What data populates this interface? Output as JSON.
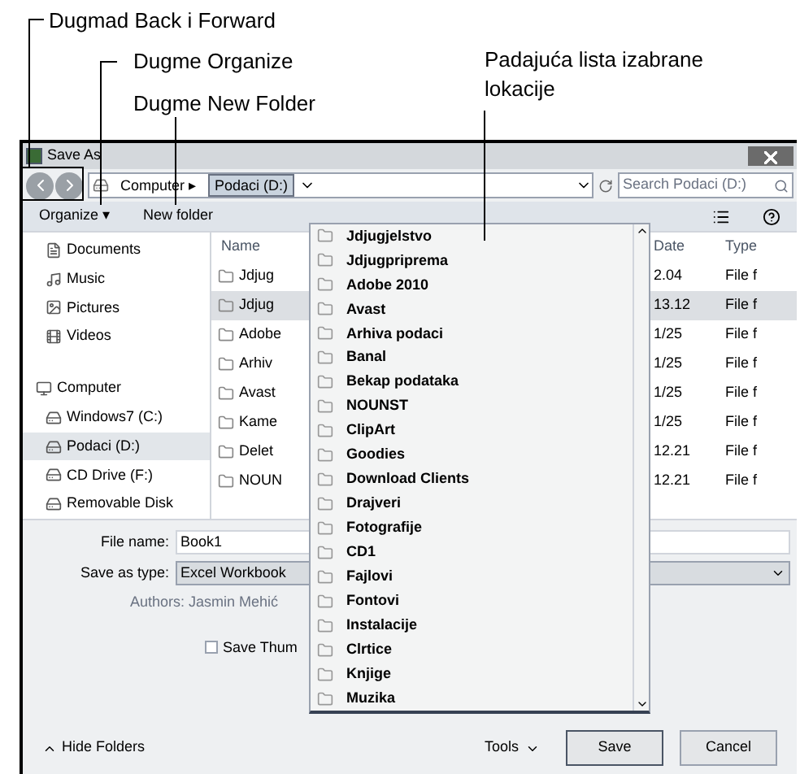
{
  "annotations": [
    {
      "text": "Dugmad Back i Forward"
    },
    {
      "text": "Dugme Organize"
    },
    {
      "text": "Dugme New Folder"
    },
    {
      "text": "Padajuća lista izabrane lokacije"
    }
  ],
  "window": {
    "title": "Save As"
  },
  "address": {
    "separator": "▸",
    "crumbs": [
      {
        "label": "Computer",
        "selected": false
      },
      {
        "label": "Podaci (D:)",
        "selected": true
      }
    ],
    "search_placeholder": "Search Podaci (D:)"
  },
  "toolbar": {
    "organize": "Organize ▾",
    "new_folder": "New folder"
  },
  "nav": [
    {
      "label": "Documents",
      "kind": "doc",
      "selected": false
    },
    {
      "label": "Music",
      "kind": "music",
      "selected": false
    },
    {
      "label": "Pictures",
      "kind": "picture",
      "selected": false
    },
    {
      "label": "Videos",
      "kind": "video",
      "selected": false
    },
    {
      "label": "Computer",
      "kind": "computer",
      "selected": false
    },
    {
      "label": "Windows7 (C:)",
      "kind": "drive",
      "selected": false
    },
    {
      "label": "Podaci (D:)",
      "kind": "drive",
      "selected": true
    },
    {
      "label": "CD Drive (F:)",
      "kind": "drive",
      "selected": false
    },
    {
      "label": "Removable Disk",
      "kind": "drive",
      "selected": false
    }
  ],
  "table": {
    "columns": [
      "Name",
      "Date",
      "Type"
    ],
    "rows": [
      {
        "name": "Jdjug",
        "date": "2.04",
        "type": "File f",
        "selected": false
      },
      {
        "name": "Jdjug",
        "date": "13.12",
        "type": "File f",
        "selected": true
      },
      {
        "name": "Adobe",
        "date": "1/25",
        "type": "File f",
        "selected": false
      },
      {
        "name": "Arhiv",
        "date": "1/25",
        "type": "File f",
        "selected": false
      },
      {
        "name": "Avast",
        "date": "1/25",
        "type": "File f",
        "selected": false
      },
      {
        "name": "Kame",
        "date": "1/25",
        "type": "File f",
        "selected": false
      },
      {
        "name": "Delet",
        "date": "12.21",
        "type": "File f",
        "selected": false
      },
      {
        "name": "NOUN",
        "date": "12.21",
        "type": "File f",
        "selected": false
      }
    ]
  },
  "dropdown": [
    "Jdjugjelstvo",
    "Jdjugpriprema",
    "Adobe 2010",
    "Avast",
    "Arhiva podaci",
    "Banal",
    "Bekap podataka",
    "NOUNST",
    "ClipArt",
    "Goodies",
    "Download Clients",
    "Drajveri",
    "Fotografije",
    "CD1",
    "Fajlovi",
    "Fontovi",
    "Instalacije",
    "Clrtice",
    "Knjige",
    "Muzika"
  ],
  "form": {
    "file_name_label": "File name:",
    "file_name": "Book1",
    "type_label": "Save as type:",
    "type": "Excel Workbook",
    "authors": "Authors: Jasmin Mehić",
    "thumbnail_label": "Save Thum",
    "thumbnail_checked": false
  },
  "footer": {
    "hide_folders": "Hide Folders",
    "tools": "Tools",
    "save": "Save",
    "cancel": "Cancel"
  }
}
